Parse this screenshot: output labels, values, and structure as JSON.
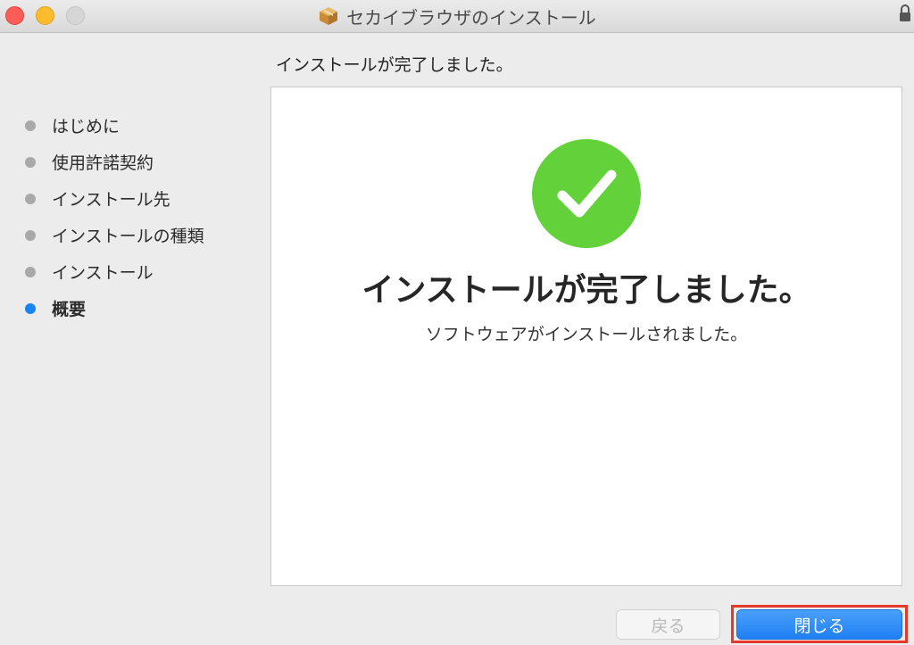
{
  "window": {
    "title": "セカイブラウザのインストール",
    "icons": {
      "app": "package-icon",
      "lock": "lock-icon"
    }
  },
  "sidebar": {
    "steps": [
      {
        "label": "はじめに",
        "active": false
      },
      {
        "label": "使用許諾契約",
        "active": false
      },
      {
        "label": "インストール先",
        "active": false
      },
      {
        "label": "インストールの種類",
        "active": false
      },
      {
        "label": "インストール",
        "active": false
      },
      {
        "label": "概要",
        "active": true
      }
    ]
  },
  "main": {
    "heading": "インストールが完了しました。",
    "status_icon": "checkmark-icon",
    "done_title": "インストールが完了しました。",
    "done_subtitle": "ソフトウェアがインストールされました。"
  },
  "buttons": {
    "back_label": "戻る",
    "close_label": "閉じる"
  },
  "colors": {
    "accent": "#1a84f6",
    "success": "#62d13a",
    "highlight": "#e4392b"
  }
}
